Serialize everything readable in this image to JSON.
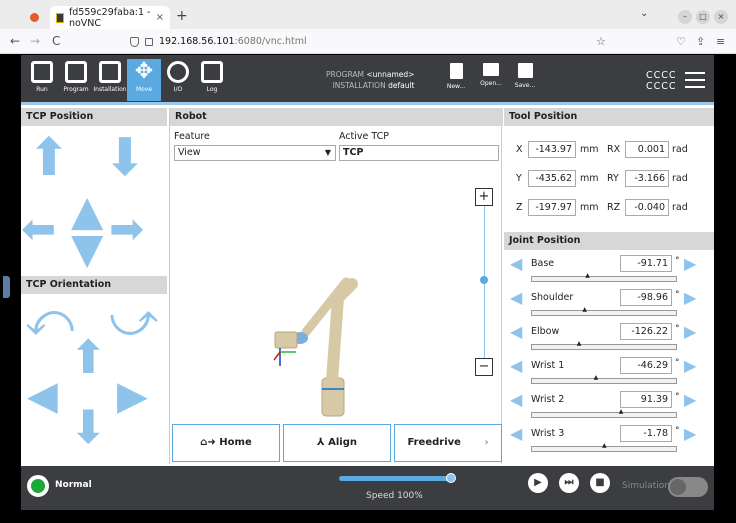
{
  "browser": {
    "tab_title": "fd559c29faba:1 - noVNC",
    "tab_close": "×",
    "new_tab": "+",
    "url_host": "192.168.56.101",
    "url_path": ":6080/vnc.html",
    "back": "←",
    "forward": "→",
    "reload": "C",
    "star": "☆"
  },
  "topbar": {
    "nav": [
      {
        "label": "Run"
      },
      {
        "label": "Program"
      },
      {
        "label": "Installation"
      },
      {
        "label": "Move"
      },
      {
        "label": "I/O"
      },
      {
        "label": "Log"
      }
    ],
    "program_label": "PROGRAM",
    "program_value": "<unnamed>",
    "installation_label": "INSTALLATION",
    "installation_value": "default",
    "new_label": "New...",
    "open_label": "Open...",
    "save_label": "Save...",
    "cccc1": "CCCC",
    "cccc2": "CCCC"
  },
  "left": {
    "tcp_position_title": "TCP Position",
    "tcp_orientation_title": "TCP Orientation"
  },
  "robot_panel": {
    "title": "Robot",
    "feature_label": "Feature",
    "feature_value": "View",
    "active_tcp_label": "Active TCP",
    "active_tcp_value": "TCP",
    "zoom_in": "+",
    "zoom_out": "−",
    "home": "Home",
    "align": "Align",
    "freedrive": "Freedrive",
    "freedrive_chevron": "›"
  },
  "tool_position": {
    "title": "Tool Position",
    "rows": [
      {
        "axis": "X",
        "value": "-143.97",
        "unit": "mm",
        "raxis": "RX",
        "rvalue": "0.001",
        "runit": "rad"
      },
      {
        "axis": "Y",
        "value": "-435.62",
        "unit": "mm",
        "raxis": "RY",
        "rvalue": "-3.166",
        "runit": "rad"
      },
      {
        "axis": "Z",
        "value": "-197.97",
        "unit": "mm",
        "raxis": "RZ",
        "rvalue": "-0.040",
        "runit": "rad"
      }
    ]
  },
  "joint_position": {
    "title": "Joint Position",
    "joints": [
      {
        "name": "Base",
        "value": "-91.71",
        "unit": "°",
        "level": 0.38
      },
      {
        "name": "Shoulder",
        "value": "-98.96",
        "unit": "°",
        "level": 0.36
      },
      {
        "name": "Elbow",
        "value": "-126.22",
        "unit": "°",
        "level": 0.32
      },
      {
        "name": "Wrist 1",
        "value": "-46.29",
        "unit": "°",
        "level": 0.44
      },
      {
        "name": "Wrist 2",
        "value": "91.39",
        "unit": "°",
        "level": 0.62
      },
      {
        "name": "Wrist 3",
        "value": "-1.78",
        "unit": "°",
        "level": 0.5
      }
    ]
  },
  "footer": {
    "status": "Normal",
    "speed": "Speed 100%",
    "simulation": "Simulation"
  },
  "colors": {
    "accent": "#8ec3ec",
    "topbar": "#3b3d40",
    "status_ok": "#1fa83a"
  }
}
